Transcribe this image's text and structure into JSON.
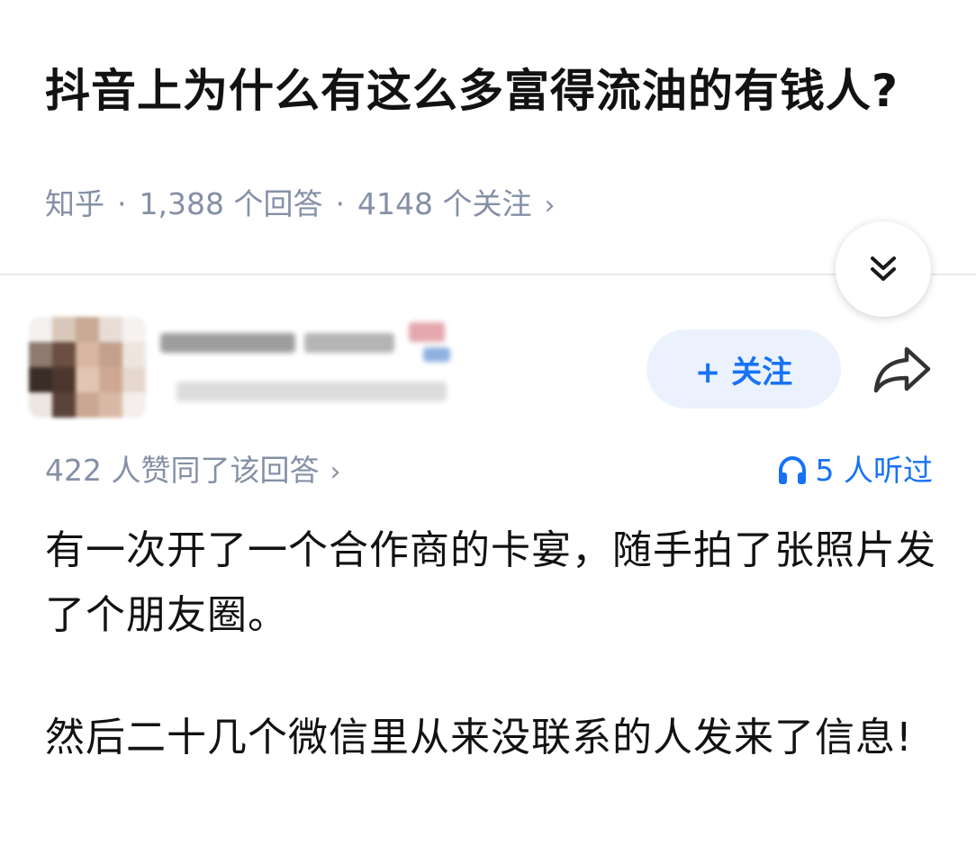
{
  "question": {
    "title": "抖音上为什么有这么多富得流油的有钱人?",
    "source": "知乎",
    "answers": "1,388 个回答",
    "followers": "4148 个关注",
    "separator": "·",
    "chevron": "›"
  },
  "author": {
    "follow_label": "+ 关注"
  },
  "answer": {
    "votes": "422 人赞同了该回答",
    "listened": "5 人听过",
    "paragraphs": [
      "有一次开了一个合作商的卡宴，随手拍了张照片发了个朋友圈。",
      "然后二十几个微信里从来没联系的人发来了信息!"
    ]
  },
  "colors": {
    "accent": "#1772f6",
    "meta_gray": "#8590a6",
    "follow_bg": "#ebf2fd"
  },
  "icons": [
    "chevron-double-down-icon",
    "share-arrow-icon",
    "headphones-icon"
  ]
}
